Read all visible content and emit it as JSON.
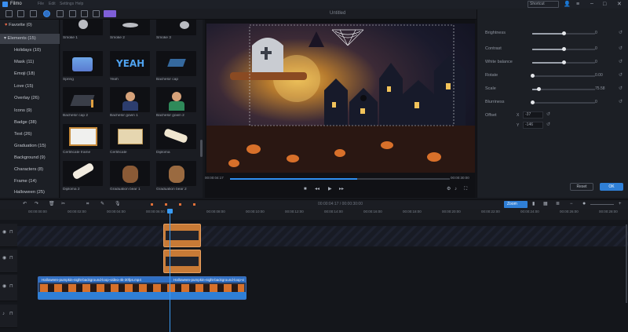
{
  "app": {
    "name": "Filmo",
    "project_title": "Untitled",
    "shortcut_label": "Shortcut"
  },
  "menu": [
    "File",
    "Edit",
    "Settings",
    "Help"
  ],
  "sidebar": {
    "items": [
      {
        "label": "Favorite (0)"
      },
      {
        "label": "Elements (15)"
      },
      {
        "label": "Holidays (10)"
      },
      {
        "label": "Mask (11)"
      },
      {
        "label": "Emoji (18)"
      },
      {
        "label": "Love (15)"
      },
      {
        "label": "Overlay (26)"
      },
      {
        "label": "Icons (9)"
      },
      {
        "label": "Badge (38)"
      },
      {
        "label": "Text (26)"
      },
      {
        "label": "Graduation (15)"
      },
      {
        "label": "Background (9)"
      },
      {
        "label": "Characters (8)"
      },
      {
        "label": "Frame (14)"
      },
      {
        "label": "Halloween (25)"
      }
    ]
  },
  "library": {
    "items": [
      {
        "label": "Smoke 1"
      },
      {
        "label": "Smoke 2"
      },
      {
        "label": "Smoke 3"
      },
      {
        "label": "Spring"
      },
      {
        "label": "Yeah"
      },
      {
        "label": "Bachelor cap"
      },
      {
        "label": "Bachelor cap 2"
      },
      {
        "label": "Bachelor gown 1"
      },
      {
        "label": "Bachelor gown 2"
      },
      {
        "label": "Certificate frame"
      },
      {
        "label": "Certificate"
      },
      {
        "label": "Diploma"
      },
      {
        "label": "Diploma 2"
      },
      {
        "label": "Graduation bear 1"
      },
      {
        "label": "Graduation bear 2"
      }
    ],
    "yeah_text": "YEAH"
  },
  "player": {
    "current_time": "00:00:04:17",
    "total_time": "00:00:30:00",
    "progress": 0.58
  },
  "properties": {
    "rows": [
      {
        "label": "Brightness",
        "value": "0",
        "fill": 0.5
      },
      {
        "label": "Contrast",
        "value": "0",
        "fill": 0.5
      },
      {
        "label": "White balance",
        "value": "0",
        "fill": 0.5
      },
      {
        "label": "Rotate",
        "value": "0.00",
        "fill": 0.0
      },
      {
        "label": "Scale",
        "value": "75.58",
        "fill": 0.1
      },
      {
        "label": "Blurriness",
        "value": "0",
        "fill": 0.0
      }
    ],
    "offset_label": "Offset",
    "x_label": "X",
    "x_value": "-37",
    "y_label": "Y",
    "y_value": "-146",
    "reset_button": "Reset",
    "ok_button": "OK"
  },
  "timeline": {
    "ruler_current": "00:00:04:17 / 00:00:30:00",
    "zoom_label": "Zoom",
    "ruler_ticks": [
      "00:00:00:00",
      "00:00:02:00",
      "00:00:04:00",
      "00:00:06:00",
      "00:00:08:00",
      "00:00:10:00",
      "00:00:12:00",
      "00:00:14:00",
      "00:00:16:00",
      "00:00:18:00",
      "00:00:20:00",
      "00:00:22:00",
      "00:00:24:00",
      "00:00:26:00",
      "00:00:28:00",
      "00:00:30:00"
    ],
    "video_clip_label": "Halloween-pumpkin-night-background-loop-video-4k-30fps.mp4",
    "video_clip_label2": "Halloween-pumpkin-night-background-loop-video-4k.mp4"
  },
  "colors": {
    "accent": "#2f8ff0",
    "clip_orange": "#d8843a",
    "clip_blue": "#2f7fd6"
  }
}
